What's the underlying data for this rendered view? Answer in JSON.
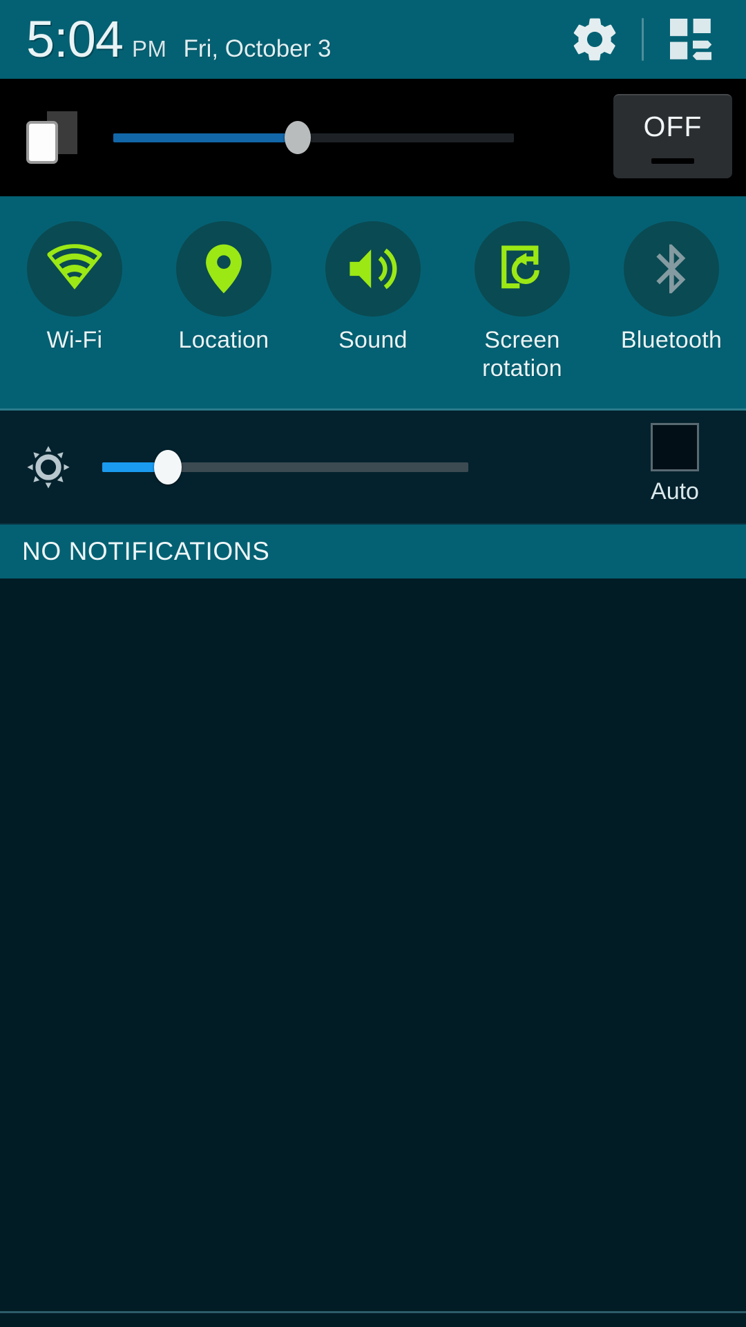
{
  "status_bar": {
    "time": "5:04",
    "ampm": "PM",
    "date": "Fri, October 3",
    "settings_icon": "gear-icon",
    "quick_settings_edit_icon": "quick-settings-grid-icon"
  },
  "dimmer_panel": {
    "app_icon": "screen-dimmer-icon",
    "slider_value_percent": 46,
    "toggle_label": "OFF",
    "toggle_state": "off",
    "fill_color": "#1267a8",
    "panel_background": "#000000"
  },
  "quick_toggles": {
    "background": "#046173",
    "circle_color": "#0a4a52",
    "active_color": "#9be815",
    "inactive_color": "#7f9aa0",
    "items": [
      {
        "label": "Wi-Fi",
        "icon": "wifi-icon",
        "state": "on"
      },
      {
        "label": "Location",
        "icon": "location-pin-icon",
        "state": "on"
      },
      {
        "label": "Sound",
        "icon": "sound-speaker-icon",
        "state": "on"
      },
      {
        "label": "Screen\nrotation",
        "icon": "screen-rotation-icon",
        "state": "on"
      },
      {
        "label": "Bluetooth",
        "icon": "bluetooth-icon",
        "state": "off"
      }
    ]
  },
  "brightness": {
    "icon": "brightness-sun-icon",
    "value_percent": 18,
    "fill_color": "#1a9bf0",
    "auto_label": "Auto",
    "auto_checked": false
  },
  "notifications": {
    "header_text": "NO NOTIFICATIONS",
    "items": []
  }
}
